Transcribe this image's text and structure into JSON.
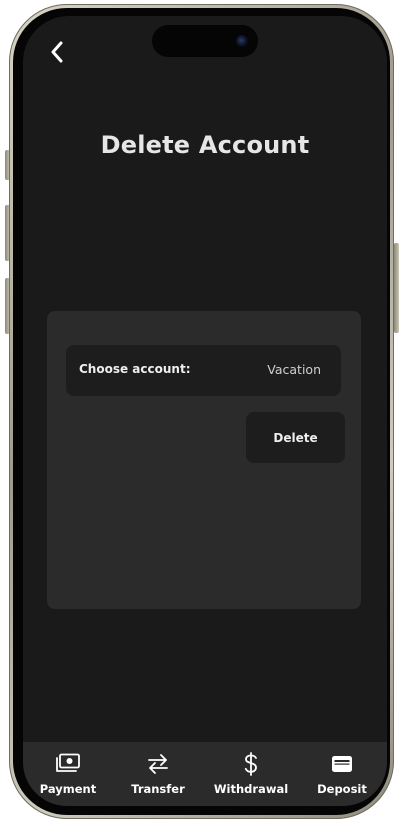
{
  "header": {
    "back_icon": "chevron-left-icon",
    "title": "Delete Account"
  },
  "form": {
    "choose_label": "Choose account:",
    "selected_account": "Vacation",
    "delete_label": "Delete"
  },
  "tabbar": {
    "tabs": [
      {
        "label": "Payment",
        "icon": "banknote-icon"
      },
      {
        "label": "Transfer",
        "icon": "transfer-arrows-icon"
      },
      {
        "label": "Withdrawal",
        "icon": "dollar-sign-icon"
      },
      {
        "label": "Deposit",
        "icon": "card-icon"
      }
    ]
  },
  "colors": {
    "screen_bg": "#1a1a1a",
    "card_bg": "#2b2b2b",
    "control_bg": "#1d1d1d",
    "text": "#e6e6e6"
  }
}
